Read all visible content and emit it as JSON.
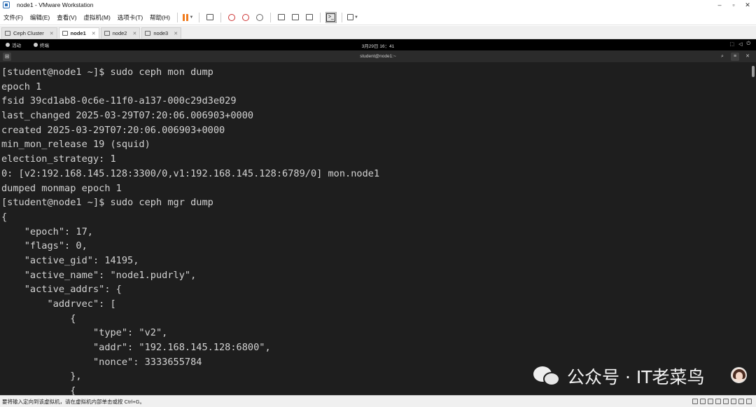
{
  "window": {
    "title": "node1 - VMware Workstation",
    "controls": [
      "–",
      "▫",
      "✕"
    ]
  },
  "menu": {
    "items": [
      "文件(F)",
      "编辑(E)",
      "查看(V)",
      "虚拟机(M)",
      "选项卡(T)",
      "帮助(H)"
    ]
  },
  "tabs": [
    {
      "label": "Ceph Cluster",
      "active": false
    },
    {
      "label": "node1",
      "active": true
    },
    {
      "label": "node2",
      "active": false
    },
    {
      "label": "node3",
      "active": false
    }
  ],
  "gnome_bar": {
    "activities": "活动",
    "app": "终端",
    "clock": "3月29日 16：41"
  },
  "terminal": {
    "title": "student@node1:~",
    "lines": [
      "[student@node1 ~]$ sudo ceph mon dump",
      "epoch 1",
      "fsid 39cd1ab8-0c6e-11f0-a137-000c29d3e029",
      "last_changed 2025-03-29T07:20:06.006903+0000",
      "created 2025-03-29T07:20:06.006903+0000",
      "min_mon_release 19 (squid)",
      "election_strategy: 1",
      "0: [v2:192.168.145.128:3300/0,v1:192.168.145.128:6789/0] mon.node1",
      "dumped monmap epoch 1",
      "[student@node1 ~]$ sudo ceph mgr dump",
      "{",
      "    \"epoch\": 17,",
      "    \"flags\": 0,",
      "    \"active_gid\": 14195,",
      "    \"active_name\": \"node1.pudrly\",",
      "    \"active_addrs\": {",
      "        \"addrvec\": [",
      "            {",
      "                \"type\": \"v2\",",
      "                \"addr\": \"192.168.145.128:6800\",",
      "                \"nonce\": 3333655784",
      "            },",
      "            {"
    ]
  },
  "watermark": {
    "text": "公众号 · IT老菜鸟"
  },
  "statusbar": {
    "message": "要将输入定向到该虚拟机，请在虚拟机内部单击或按 Ctrl+G。"
  }
}
